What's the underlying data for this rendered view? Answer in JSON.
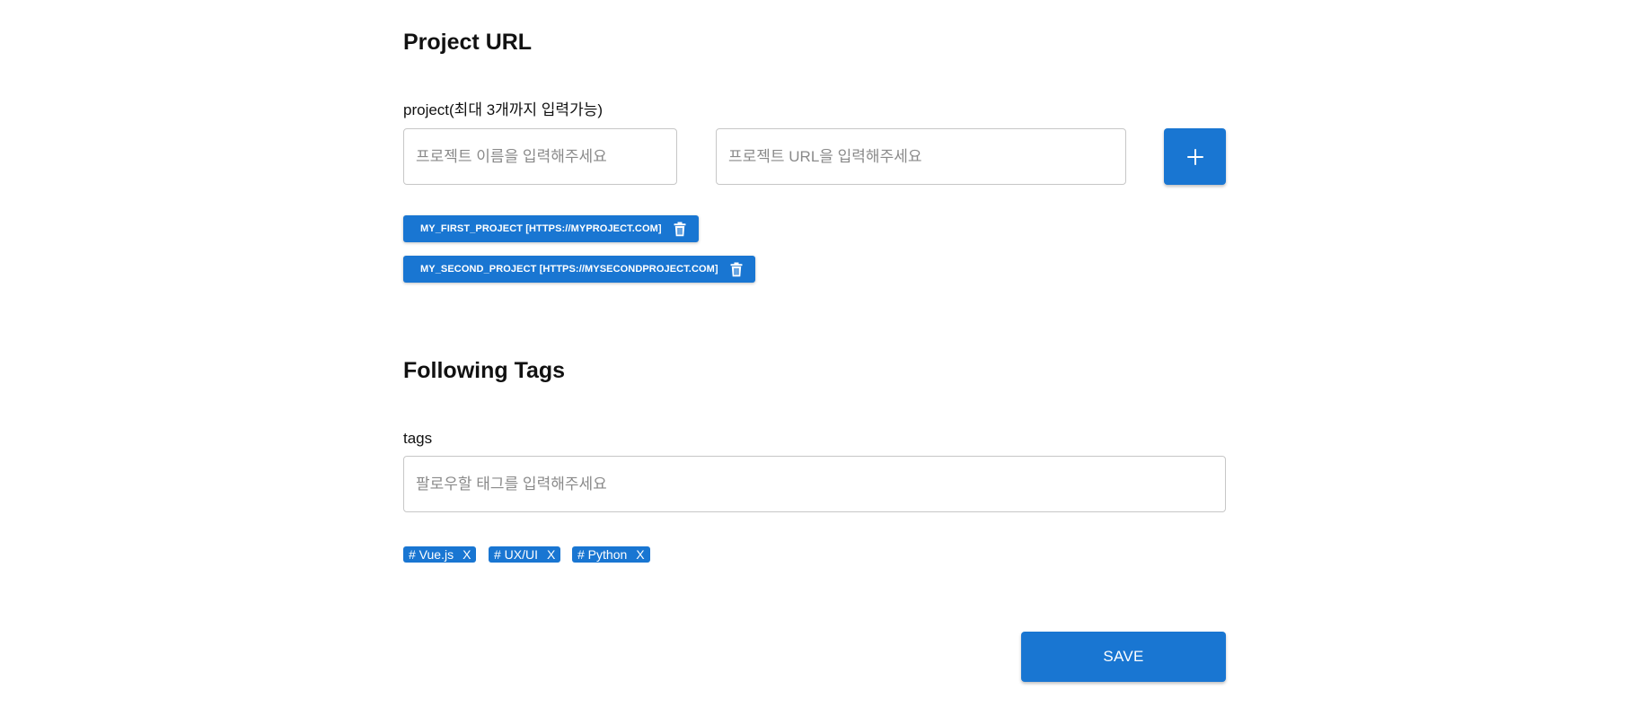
{
  "project_section": {
    "title": "Project URL",
    "field_label": "project(최대 3개까지 입력가능)",
    "name_placeholder": "프로젝트 이름을 입력해주세요",
    "url_placeholder": "프로젝트 URL을 입력해주세요",
    "add_icon": "plus-icon",
    "projects": [
      {
        "label": "MY_FIRST_PROJECT [HTTPS://MYPROJECT.COM]",
        "icon": "trash-icon"
      },
      {
        "label": "MY_SECOND_PROJECT [HTTPS://MYSECONDPROJECT.COM]",
        "icon": "trash-icon"
      }
    ]
  },
  "tags_section": {
    "title": "Following Tags",
    "field_label": "tags",
    "placeholder": "팔로우할 태그를 입력해주세요",
    "tags": [
      {
        "label": "# Vue.js",
        "remove": "X"
      },
      {
        "label": "# UX/UI",
        "remove": "X"
      },
      {
        "label": "# Python",
        "remove": "X"
      }
    ]
  },
  "save_label": "SAVE",
  "colors": {
    "primary": "#1976d2",
    "border": "#c7c7c7",
    "placeholder": "#8a8a8a"
  }
}
